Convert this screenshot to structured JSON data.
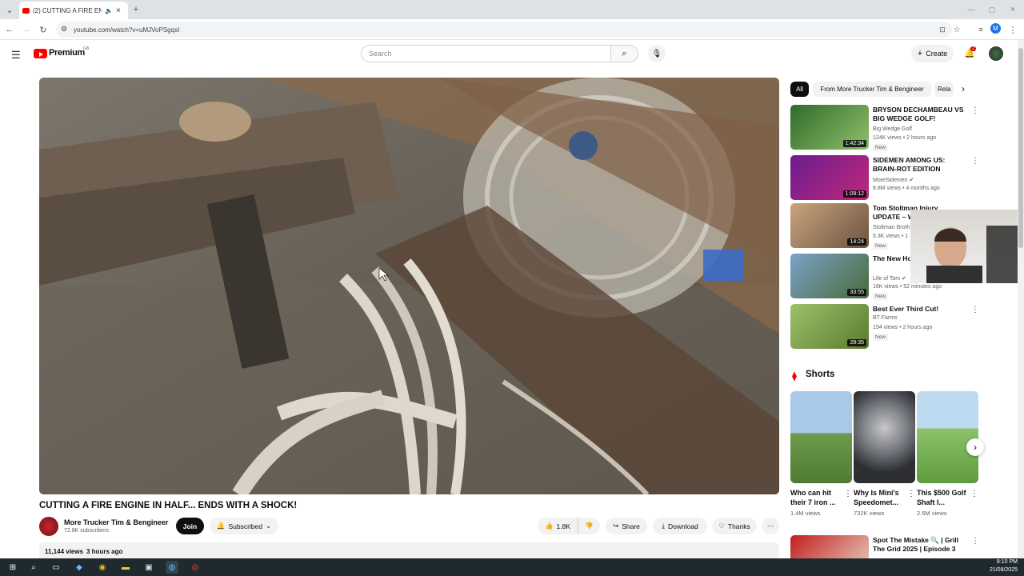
{
  "browser": {
    "tab_title": "(2) CUTTING A FIRE ENGINE",
    "url": "youtube.com/watch?v=uMJVoPSgqsI"
  },
  "header": {
    "logo": "Premium",
    "region": "GB",
    "search_placeholder": "Search",
    "create_label": "Create",
    "notif_count": "2",
    "profile_initial": "M"
  },
  "video": {
    "title": "CUTTING A FIRE ENGINE IN HALF... ENDS WITH A SHOCK!",
    "channel": "More Trucker Tim & Bengineer",
    "subscribers": "72.8K subscribers",
    "join_label": "Join",
    "subscribed_label": "Subscribed",
    "likes": "1.8K",
    "share_label": "Share",
    "download_label": "Download",
    "thanks_label": "Thanks",
    "views": "11,144 views",
    "age": "3 hours ago"
  },
  "chips": [
    "All",
    "From More Trucker Tim & Bengineer",
    "Rela"
  ],
  "recs": [
    {
      "title": "BRYSON DECHAMBEAU VS BIG WEDGE GOLF!",
      "channel": "Big Wedge Golf",
      "meta": "124K views • 2 hours ago",
      "badge": "New",
      "duration": "1:42:34",
      "color": "#3e7a3a"
    },
    {
      "title": "SIDEMEN AMONG US: BRAIN-ROT EDITION",
      "channel": "MoreSidemen ✔",
      "meta": "8.8M views • 4 months ago",
      "badge": "",
      "duration": "1:09:12",
      "color": "#b0267e"
    },
    {
      "title": "Tom Stoltman Injury UPDATE – What's Next",
      "channel": "Stoltman Broth",
      "meta": "5.3K views • 1",
      "badge": "New",
      "duration": "14:24",
      "color": "#a48462"
    },
    {
      "title": "The New Ho Looking so G",
      "channel": "Life of Tom ✔",
      "meta": "16K views • 52 minutes ago",
      "badge": "New",
      "duration": "33:55",
      "color": "#5e7f9c"
    },
    {
      "title": "Best Ever Third Cut!",
      "channel": "BT Farms",
      "meta": "194 views • 2 hours ago",
      "badge": "New",
      "duration": "28:35",
      "color": "#6e8b3d"
    }
  ],
  "shorts_heading": "Shorts",
  "shorts": [
    {
      "title": "Who can hit their 7 iron ...",
      "views": "1.4M views",
      "color": "#7aa65b"
    },
    {
      "title": "Why Is Mini's Speedomet...",
      "views": "732K views",
      "color": "#4c4f55"
    },
    {
      "title": "This $500 Golf Shaft I...",
      "views": "2.5M views",
      "color": "#8fbf6a"
    }
  ],
  "bottom_rec": {
    "title": "Spot The Mistake 🔍 | Grill The Grid 2025 | Episode 3"
  },
  "taskbar": {
    "time": "8:10 PM",
    "date": "21/08/2025"
  }
}
